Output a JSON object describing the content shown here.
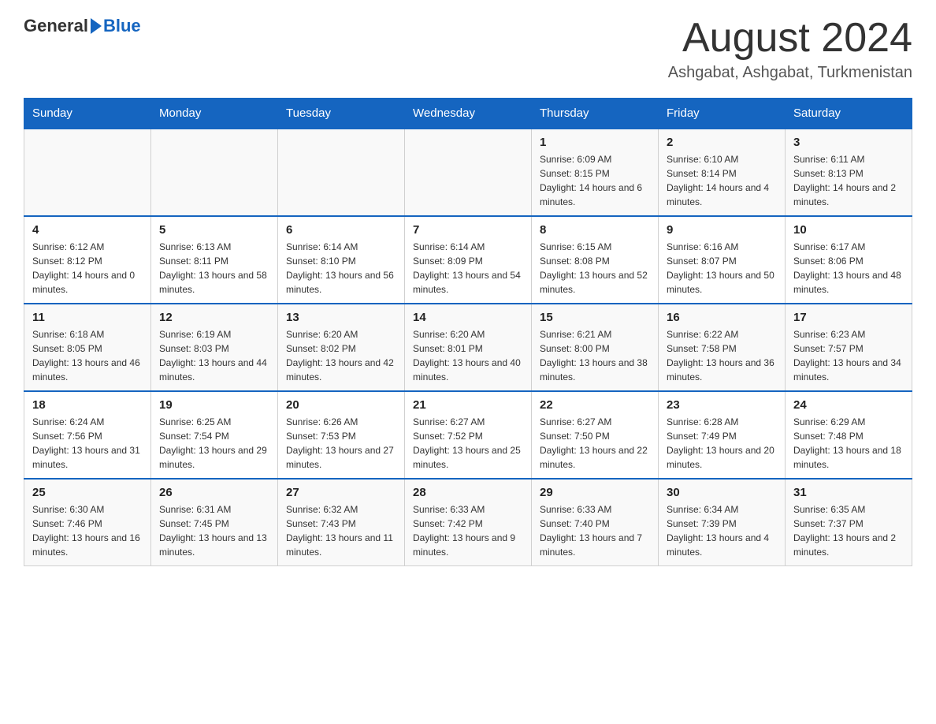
{
  "logo": {
    "general": "General",
    "triangle": "",
    "blue": "Blue"
  },
  "title": {
    "month_year": "August 2024",
    "location": "Ashgabat, Ashgabat, Turkmenistan"
  },
  "weekdays": [
    "Sunday",
    "Monday",
    "Tuesday",
    "Wednesday",
    "Thursday",
    "Friday",
    "Saturday"
  ],
  "weeks": [
    [
      {
        "day": "",
        "info": ""
      },
      {
        "day": "",
        "info": ""
      },
      {
        "day": "",
        "info": ""
      },
      {
        "day": "",
        "info": ""
      },
      {
        "day": "1",
        "info": "Sunrise: 6:09 AM\nSunset: 8:15 PM\nDaylight: 14 hours and 6 minutes."
      },
      {
        "day": "2",
        "info": "Sunrise: 6:10 AM\nSunset: 8:14 PM\nDaylight: 14 hours and 4 minutes."
      },
      {
        "day": "3",
        "info": "Sunrise: 6:11 AM\nSunset: 8:13 PM\nDaylight: 14 hours and 2 minutes."
      }
    ],
    [
      {
        "day": "4",
        "info": "Sunrise: 6:12 AM\nSunset: 8:12 PM\nDaylight: 14 hours and 0 minutes."
      },
      {
        "day": "5",
        "info": "Sunrise: 6:13 AM\nSunset: 8:11 PM\nDaylight: 13 hours and 58 minutes."
      },
      {
        "day": "6",
        "info": "Sunrise: 6:14 AM\nSunset: 8:10 PM\nDaylight: 13 hours and 56 minutes."
      },
      {
        "day": "7",
        "info": "Sunrise: 6:14 AM\nSunset: 8:09 PM\nDaylight: 13 hours and 54 minutes."
      },
      {
        "day": "8",
        "info": "Sunrise: 6:15 AM\nSunset: 8:08 PM\nDaylight: 13 hours and 52 minutes."
      },
      {
        "day": "9",
        "info": "Sunrise: 6:16 AM\nSunset: 8:07 PM\nDaylight: 13 hours and 50 minutes."
      },
      {
        "day": "10",
        "info": "Sunrise: 6:17 AM\nSunset: 8:06 PM\nDaylight: 13 hours and 48 minutes."
      }
    ],
    [
      {
        "day": "11",
        "info": "Sunrise: 6:18 AM\nSunset: 8:05 PM\nDaylight: 13 hours and 46 minutes."
      },
      {
        "day": "12",
        "info": "Sunrise: 6:19 AM\nSunset: 8:03 PM\nDaylight: 13 hours and 44 minutes."
      },
      {
        "day": "13",
        "info": "Sunrise: 6:20 AM\nSunset: 8:02 PM\nDaylight: 13 hours and 42 minutes."
      },
      {
        "day": "14",
        "info": "Sunrise: 6:20 AM\nSunset: 8:01 PM\nDaylight: 13 hours and 40 minutes."
      },
      {
        "day": "15",
        "info": "Sunrise: 6:21 AM\nSunset: 8:00 PM\nDaylight: 13 hours and 38 minutes."
      },
      {
        "day": "16",
        "info": "Sunrise: 6:22 AM\nSunset: 7:58 PM\nDaylight: 13 hours and 36 minutes."
      },
      {
        "day": "17",
        "info": "Sunrise: 6:23 AM\nSunset: 7:57 PM\nDaylight: 13 hours and 34 minutes."
      }
    ],
    [
      {
        "day": "18",
        "info": "Sunrise: 6:24 AM\nSunset: 7:56 PM\nDaylight: 13 hours and 31 minutes."
      },
      {
        "day": "19",
        "info": "Sunrise: 6:25 AM\nSunset: 7:54 PM\nDaylight: 13 hours and 29 minutes."
      },
      {
        "day": "20",
        "info": "Sunrise: 6:26 AM\nSunset: 7:53 PM\nDaylight: 13 hours and 27 minutes."
      },
      {
        "day": "21",
        "info": "Sunrise: 6:27 AM\nSunset: 7:52 PM\nDaylight: 13 hours and 25 minutes."
      },
      {
        "day": "22",
        "info": "Sunrise: 6:27 AM\nSunset: 7:50 PM\nDaylight: 13 hours and 22 minutes."
      },
      {
        "day": "23",
        "info": "Sunrise: 6:28 AM\nSunset: 7:49 PM\nDaylight: 13 hours and 20 minutes."
      },
      {
        "day": "24",
        "info": "Sunrise: 6:29 AM\nSunset: 7:48 PM\nDaylight: 13 hours and 18 minutes."
      }
    ],
    [
      {
        "day": "25",
        "info": "Sunrise: 6:30 AM\nSunset: 7:46 PM\nDaylight: 13 hours and 16 minutes."
      },
      {
        "day": "26",
        "info": "Sunrise: 6:31 AM\nSunset: 7:45 PM\nDaylight: 13 hours and 13 minutes."
      },
      {
        "day": "27",
        "info": "Sunrise: 6:32 AM\nSunset: 7:43 PM\nDaylight: 13 hours and 11 minutes."
      },
      {
        "day": "28",
        "info": "Sunrise: 6:33 AM\nSunset: 7:42 PM\nDaylight: 13 hours and 9 minutes."
      },
      {
        "day": "29",
        "info": "Sunrise: 6:33 AM\nSunset: 7:40 PM\nDaylight: 13 hours and 7 minutes."
      },
      {
        "day": "30",
        "info": "Sunrise: 6:34 AM\nSunset: 7:39 PM\nDaylight: 13 hours and 4 minutes."
      },
      {
        "day": "31",
        "info": "Sunrise: 6:35 AM\nSunset: 7:37 PM\nDaylight: 13 hours and 2 minutes."
      }
    ]
  ]
}
